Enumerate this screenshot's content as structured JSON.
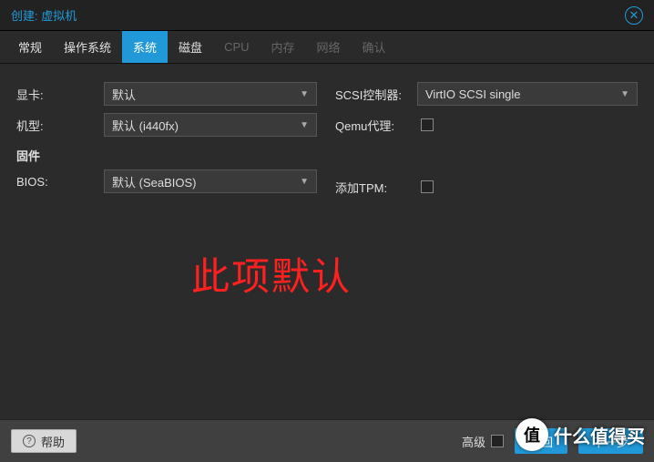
{
  "window": {
    "title": "创建: 虚拟机"
  },
  "tabs": [
    {
      "label": "常规",
      "state": "enabled"
    },
    {
      "label": "操作系统",
      "state": "enabled"
    },
    {
      "label": "系统",
      "state": "active"
    },
    {
      "label": "磁盘",
      "state": "enabled"
    },
    {
      "label": "CPU",
      "state": "disabled"
    },
    {
      "label": "内存",
      "state": "disabled"
    },
    {
      "label": "网络",
      "state": "disabled"
    },
    {
      "label": "确认",
      "state": "disabled"
    }
  ],
  "fields": {
    "graphics": {
      "label": "显卡:",
      "value": "默认"
    },
    "machine": {
      "label": "机型:",
      "value": "默认 (i440fx)"
    },
    "firmware_section": "固件",
    "bios": {
      "label": "BIOS:",
      "value": "默认 (SeaBIOS)"
    },
    "scsi": {
      "label": "SCSI控制器:",
      "value": "VirtIO SCSI single"
    },
    "qemu_agent": {
      "label": "Qemu代理:",
      "checked": false
    },
    "add_tpm": {
      "label": "添加TPM:",
      "checked": false
    }
  },
  "annotation": "此项默认",
  "footer": {
    "help": "帮助",
    "advanced": "高级",
    "back": "返回",
    "next": "下一步"
  },
  "watermark": {
    "icon": "值",
    "text": "什么值得买"
  }
}
